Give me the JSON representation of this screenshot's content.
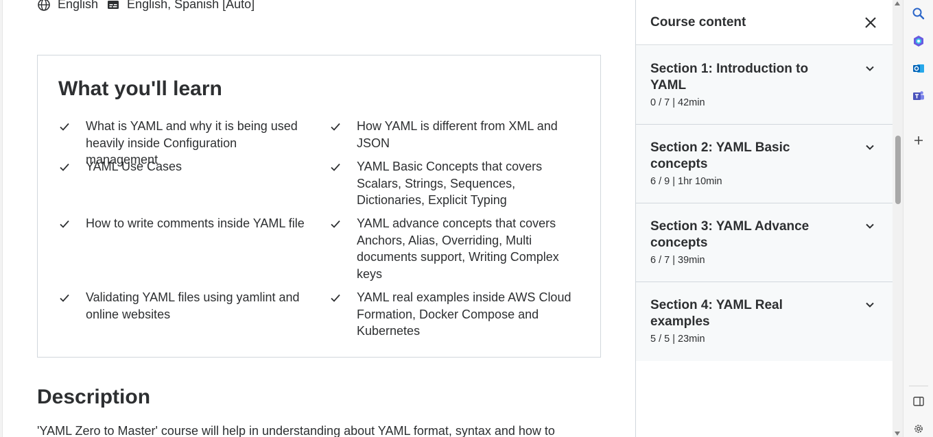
{
  "lang": {
    "audio": "English",
    "captions": "English, Spanish [Auto]"
  },
  "learn": {
    "title": "What you'll learn",
    "items": [
      "What is YAML and why it is being used heavily inside Configuration management",
      "How YAML is different from XML and JSON",
      "YAML Use Cases",
      "YAML Basic Concepts that covers Scalars, Strings, Sequences, Dictionaries, Explicit Typing",
      "How to write comments inside YAML file",
      "YAML advance concepts that covers Anchors, Alias, Overriding, Multi documents support, Writing Complex keys",
      "Validating YAML files using yamlint and online websites",
      "YAML real examples inside AWS Cloud Formation, Docker Compose and Kubernetes"
    ]
  },
  "description": {
    "title": "Description",
    "text": "'YAML Zero to Master' course will help in understanding about YAML format, syntax and how to"
  },
  "sidebar": {
    "title": "Course content",
    "sections": [
      {
        "title": "Section 1: Introduction to YAML",
        "meta": "0 / 7 | 42min"
      },
      {
        "title": "Section 2: YAML Basic concepts",
        "meta": "6 / 9 | 1hr 10min"
      },
      {
        "title": "Section 3: YAML Advance concepts",
        "meta": "6 / 7 | 39min"
      },
      {
        "title": "Section 4: YAML Real examples",
        "meta": "5 / 5 | 23min"
      }
    ]
  },
  "rail": {
    "icons": [
      "search-icon",
      "copilot-icon",
      "outlook-icon",
      "teams-icon",
      "add-icon",
      "sidebar-toggle-icon",
      "settings-icon"
    ]
  },
  "colors": {
    "text": "#2d2f31",
    "border": "#d1d7dc",
    "section_bg": "#f7f9fa",
    "accent": "#5624d0"
  }
}
